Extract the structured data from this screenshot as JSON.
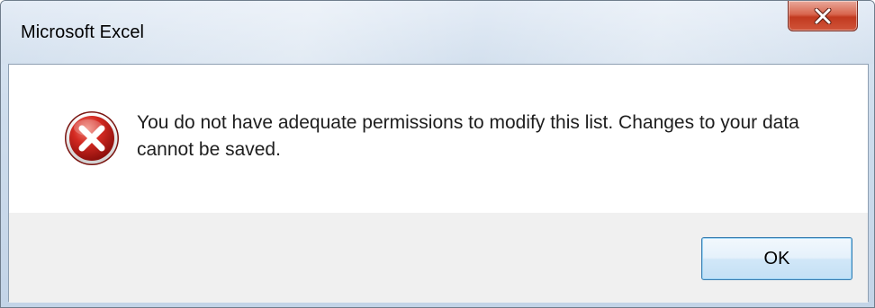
{
  "window": {
    "title": "Microsoft Excel"
  },
  "titlebar": {
    "close_icon": "close-icon"
  },
  "dialog": {
    "icon": "error-icon",
    "message": "You do not have adequate permissions to modify this list. Changes to your data cannot be saved."
  },
  "buttons": {
    "ok_label": "OK"
  },
  "colors": {
    "close_button": "#c7432a",
    "error_icon": "#c41a1a",
    "ok_border": "#3c7fb1",
    "footer_bg": "#f0f0f0"
  }
}
